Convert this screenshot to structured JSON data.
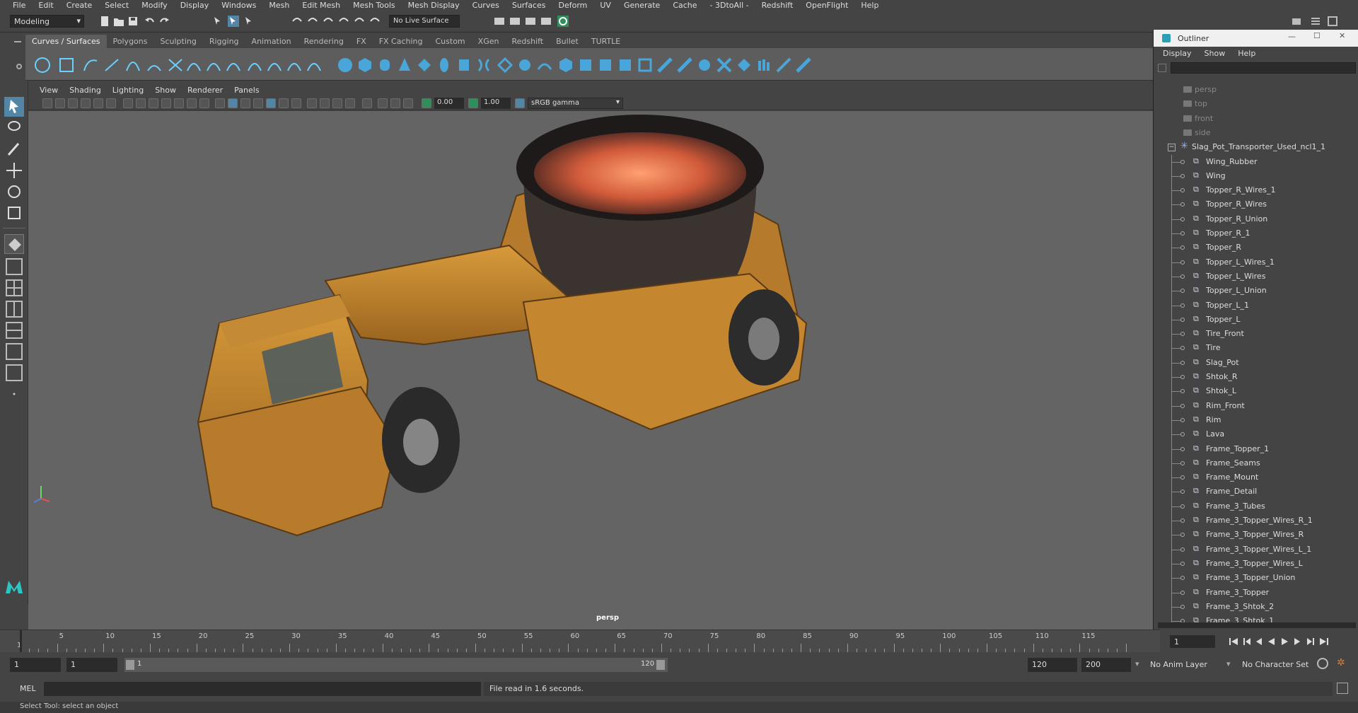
{
  "menu": [
    "File",
    "Edit",
    "Create",
    "Select",
    "Modify",
    "Display",
    "Windows",
    "Mesh",
    "Edit Mesh",
    "Mesh Tools",
    "Mesh Display",
    "Curves",
    "Surfaces",
    "Deform",
    "UV",
    "Generate",
    "Cache",
    "- 3DtoAll -",
    "Redshift",
    "OpenFlight",
    "Help"
  ],
  "status": {
    "menu_set": "Modeling",
    "live_surface": "No Live Surface"
  },
  "shelf": {
    "tabs": [
      "Curves / Surfaces",
      "Polygons",
      "Sculpting",
      "Rigging",
      "Animation",
      "Rendering",
      "FX",
      "FX Caching",
      "Custom",
      "XGen",
      "Redshift",
      "Bullet",
      "TURTLE"
    ],
    "active_tab": "Curves / Surfaces"
  },
  "viewport": {
    "menu": [
      "View",
      "Shading",
      "Lighting",
      "Show",
      "Renderer",
      "Panels"
    ],
    "exposure": "0.00",
    "gamma": "1.00",
    "color_space": "sRGB gamma",
    "camera_label": "persp",
    "bg_color": "#646464"
  },
  "outliner": {
    "title": "Outliner",
    "menu": [
      "Display",
      "Show",
      "Help"
    ],
    "cameras": [
      "persp",
      "top",
      "front",
      "side"
    ],
    "group": "Slag_Pot_Transporter_Used_ncl1_1",
    "children": [
      "Wing_Rubber",
      "Wing",
      "Topper_R_Wires_1",
      "Topper_R_Wires",
      "Topper_R_Union",
      "Topper_R_1",
      "Topper_R",
      "Topper_L_Wires_1",
      "Topper_L_Wires",
      "Topper_L_Union",
      "Topper_L_1",
      "Topper_L",
      "Tire_Front",
      "Tire",
      "Slag_Pot",
      "Shtok_R",
      "Shtok_L",
      "Rim_Front",
      "Rim",
      "Lava",
      "Frame_Topper_1",
      "Frame_Seams",
      "Frame_Mount",
      "Frame_Detail",
      "Frame_3_Tubes",
      "Frame_3_Topper_Wires_R_1",
      "Frame_3_Topper_Wires_R",
      "Frame_3_Topper_Wires_L_1",
      "Frame_3_Topper_Wires_L",
      "Frame_3_Topper_Union",
      "Frame_3_Topper",
      "Frame_3_Shtok_2",
      "Frame_3_Shtok_1"
    ]
  },
  "timeline": {
    "ticks": [
      "5",
      "10",
      "15",
      "20",
      "25",
      "30",
      "35",
      "40",
      "45",
      "50",
      "55",
      "60",
      "65",
      "70",
      "75",
      "80",
      "85",
      "90",
      "95",
      "100",
      "105",
      "110",
      "115"
    ],
    "first_label": "1",
    "current_frame": "1"
  },
  "range": {
    "start": "1",
    "playback_start": "1",
    "slider_start": "1",
    "slider_end": "120",
    "playback_end": "120",
    "end": "200",
    "anim_layer": "No Anim Layer",
    "char_set": "No Character Set"
  },
  "command": {
    "lang": "MEL",
    "result": "File read in  1.6 seconds."
  },
  "help_line": "Select Tool: select an object",
  "colors": {
    "accent": "#5285a6",
    "vehicle": "#c98a2e",
    "lava": "#e8754a"
  }
}
